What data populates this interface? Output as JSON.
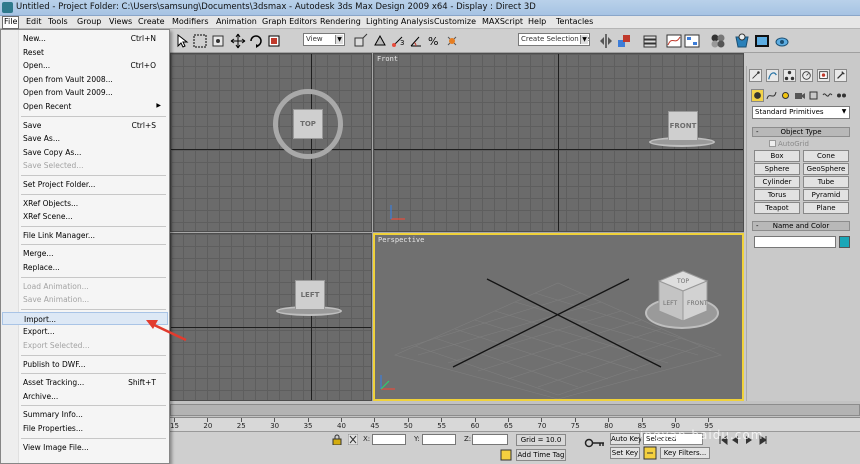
{
  "window": {
    "title": "Untitled   - Project Folder: C:\\Users\\samsung\\Documents\\3dsmax   - Autodesk 3ds Max Design 2009 x64   - Display : Direct 3D"
  },
  "menubar": {
    "items": [
      "File",
      "Edit",
      "Tools",
      "Group",
      "Views",
      "Create",
      "Modifiers",
      "Animation",
      "Graph Editors",
      "Rendering",
      "Lighting Analysis",
      "Customize",
      "MAXScript",
      "Help",
      "Tentacles"
    ],
    "active": "File"
  },
  "toolbar": {
    "view_dropdown": "View",
    "selection_set_placeholder": "Create Selection Set"
  },
  "file_menu": {
    "items": [
      {
        "label": "New...",
        "shortcut": "Ctrl+N",
        "enabled": true
      },
      {
        "label": "Reset",
        "shortcut": "",
        "enabled": true
      },
      {
        "label": "Open...",
        "shortcut": "Ctrl+O",
        "enabled": true
      },
      {
        "label": "Open from Vault 2008...",
        "shortcut": "",
        "enabled": true
      },
      {
        "label": "Open from Vault 2009...",
        "shortcut": "",
        "enabled": true
      },
      {
        "label": "Open Recent",
        "shortcut": "",
        "enabled": true,
        "submenu": true
      },
      {
        "label": "Save",
        "shortcut": "Ctrl+S",
        "enabled": true
      },
      {
        "label": "Save As...",
        "shortcut": "",
        "enabled": true
      },
      {
        "label": "Save Copy As...",
        "shortcut": "",
        "enabled": true
      },
      {
        "label": "Save Selected...",
        "shortcut": "",
        "enabled": false
      },
      {
        "label": "Set Project Folder...",
        "shortcut": "",
        "enabled": true
      },
      {
        "label": "XRef Objects...",
        "shortcut": "",
        "enabled": true
      },
      {
        "label": "XRef Scene...",
        "shortcut": "",
        "enabled": true
      },
      {
        "label": "File Link Manager...",
        "shortcut": "",
        "enabled": true
      },
      {
        "label": "Merge...",
        "shortcut": "",
        "enabled": true
      },
      {
        "label": "Replace...",
        "shortcut": "",
        "enabled": true
      },
      {
        "label": "Load Animation...",
        "shortcut": "",
        "enabled": false
      },
      {
        "label": "Save Animation...",
        "shortcut": "",
        "enabled": false
      },
      {
        "label": "Import...",
        "shortcut": "",
        "enabled": true,
        "highlighted": true
      },
      {
        "label": "Export...",
        "shortcut": "",
        "enabled": true
      },
      {
        "label": "Export Selected...",
        "shortcut": "",
        "enabled": false
      },
      {
        "label": "Publish to DWF...",
        "shortcut": "",
        "enabled": true
      },
      {
        "label": "Asset Tracking...",
        "shortcut": "Shift+T",
        "enabled": true
      },
      {
        "label": "Archive...",
        "shortcut": "",
        "enabled": true
      },
      {
        "label": "Summary Info...",
        "shortcut": "",
        "enabled": true
      },
      {
        "label": "File Properties...",
        "shortcut": "",
        "enabled": true
      },
      {
        "label": "View Image File...",
        "shortcut": "",
        "enabled": true
      }
    ]
  },
  "viewports": {
    "top": {
      "cube_label": "TOP"
    },
    "front": {
      "label": "Front",
      "cube_label": "FRONT"
    },
    "left": {
      "cube_label": "LEFT"
    },
    "perspective": {
      "label": "Perspective",
      "cube_faces": [
        "TOP",
        "LEFT",
        "FRONT"
      ]
    }
  },
  "command_panel": {
    "category": "Standard Primitives",
    "object_type_title": "Object Type",
    "autogrid_label": "AutoGrid",
    "primitives": [
      "Box",
      "Cone",
      "Sphere",
      "GeoSphere",
      "Cylinder",
      "Tube",
      "Torus",
      "Pyramid",
      "Teapot",
      "Plane"
    ],
    "name_color_title": "Name and Color",
    "swatch_color": "#1aa6b7"
  },
  "timeline": {
    "ticks": [
      "15",
      "20",
      "25",
      "30",
      "35",
      "40",
      "45",
      "50",
      "55",
      "60",
      "65",
      "70",
      "75",
      "80",
      "85",
      "90",
      "95"
    ]
  },
  "status": {
    "x_label": "X:",
    "y_label": "Y:",
    "z_label": "Z:",
    "grid": "Grid = 10.0",
    "add_time_tag": "Add Time Tag",
    "auto_key": "Auto Key",
    "set_key": "Set Key",
    "selected": "Selected",
    "key_filters": "Key Filters..."
  },
  "watermark": "ingyan.baidu.com",
  "colors": {
    "active_viewport_border": "#f0d23a",
    "menu_highlight": "#dde8f5",
    "annotation_arrow": "#e23b2e"
  }
}
